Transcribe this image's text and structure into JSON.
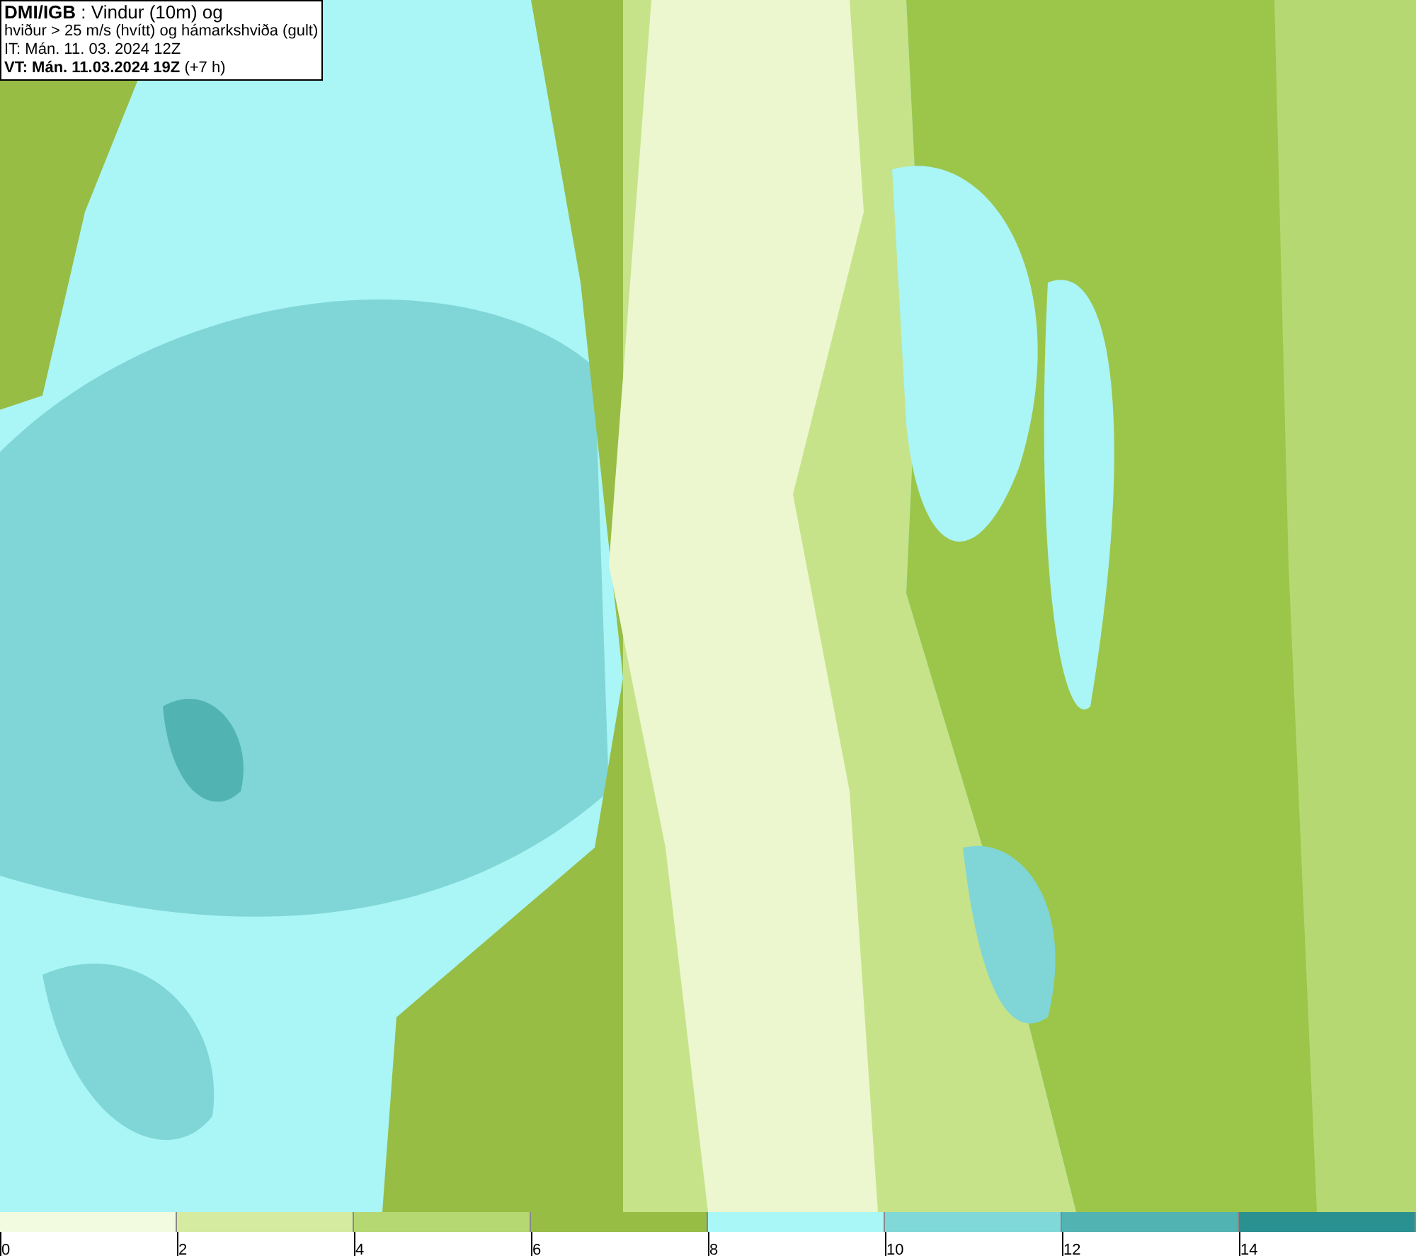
{
  "info_box": {
    "lines": [
      "**DMI/IGB** : Vindur (10m) og",
      "hviður > 25 m/s (hvítt) og hámarkshviða (gult)",
      "IT: Mán. 11. 03. 2024 12Z",
      "**VT: Mán. 11.03.2024 19Z** (+7 h)"
    ]
  },
  "legend": {
    "bins": [
      {
        "color": "#f2fae0"
      },
      {
        "color": "#d4eba0"
      },
      {
        "color": "#b6d872"
      },
      {
        "color": "#97bd45"
      },
      {
        "color": "#aaf7f7"
      },
      {
        "color": "#80d8d8"
      },
      {
        "color": "#52b3b3"
      },
      {
        "color": "#2a9090"
      }
    ],
    "ticks": [
      "0",
      "2",
      "4",
      "6",
      "8",
      "10",
      "12",
      "14"
    ]
  }
}
